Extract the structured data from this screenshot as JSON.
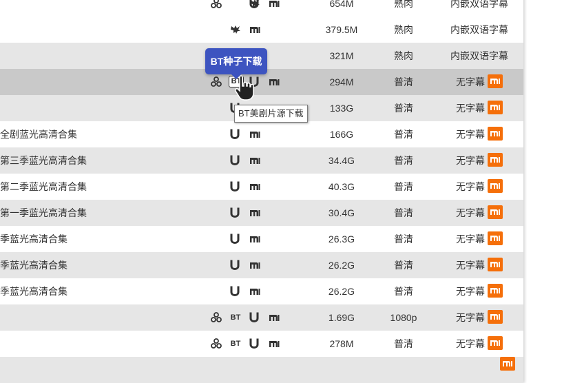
{
  "rows": [
    {
      "title": "",
      "icons": [
        "share",
        "magnet",
        "thunder",
        "mi"
      ],
      "size": "654M",
      "quality": "熟肉",
      "subtitle": "内嵌双语字幕",
      "mi_badge": false,
      "style": "plain"
    },
    {
      "title": "",
      "icons": [
        "thunder",
        "mi"
      ],
      "size": "379.5M",
      "quality": "熟肉",
      "subtitle": "内嵌双语字幕",
      "mi_badge": false,
      "style": "plain"
    },
    {
      "title": "",
      "icons": [],
      "size": "321M",
      "quality": "熟肉",
      "subtitle": "内嵌双语字幕",
      "mi_badge": false,
      "style": "alt"
    },
    {
      "title": "",
      "icons": [
        "share",
        "bt-boxed",
        "magnet",
        "mi"
      ],
      "size": "294M",
      "quality": "普清",
      "subtitle": "无字幕",
      "mi_badge": true,
      "style": "hover"
    },
    {
      "title": "",
      "icons": [
        "magnet"
      ],
      "size": "133G",
      "quality": "普清",
      "subtitle": "无字幕",
      "mi_badge": true,
      "style": "alt"
    },
    {
      "title": "全剧蓝光高清合集",
      "icons": [
        "magnet",
        "mi2"
      ],
      "size": "166G",
      "quality": "普清",
      "subtitle": "无字幕",
      "mi_badge": true,
      "style": "plain"
    },
    {
      "title": " 第三季蓝光高清合集",
      "icons": [
        "magnet",
        "mi2"
      ],
      "size": "34.4G",
      "quality": "普清",
      "subtitle": "无字幕",
      "mi_badge": true,
      "style": "alt"
    },
    {
      "title": " 第二季蓝光高清合集",
      "icons": [
        "magnet",
        "mi2"
      ],
      "size": "40.3G",
      "quality": "普清",
      "subtitle": "无字幕",
      "mi_badge": true,
      "style": "plain"
    },
    {
      "title": " 第一季蓝光高清合集",
      "icons": [
        "magnet",
        "mi2"
      ],
      "size": "30.4G",
      "quality": "普清",
      "subtitle": "无字幕",
      "mi_badge": true,
      "style": "alt"
    },
    {
      "title": "季蓝光高清合集",
      "icons": [
        "magnet",
        "mi2"
      ],
      "size": "26.3G",
      "quality": "普清",
      "subtitle": "无字幕",
      "mi_badge": true,
      "style": "plain"
    },
    {
      "title": "季蓝光高清合集",
      "icons": [
        "magnet",
        "mi2"
      ],
      "size": "26.2G",
      "quality": "普清",
      "subtitle": "无字幕",
      "mi_badge": true,
      "style": "alt"
    },
    {
      "title": "季蓝光高清合集",
      "icons": [
        "magnet",
        "mi2"
      ],
      "size": "26.2G",
      "quality": "普清",
      "subtitle": "无字幕",
      "mi_badge": true,
      "style": "plain"
    },
    {
      "title": "",
      "icons": [
        "share",
        "bt",
        "magnet",
        "mi"
      ],
      "size": "1.69G",
      "quality": "1080p",
      "subtitle": "无字幕",
      "mi_badge": true,
      "style": "alt"
    },
    {
      "title": "",
      "icons": [
        "share",
        "bt",
        "magnet",
        "mi"
      ],
      "size": "278M",
      "quality": "普清",
      "subtitle": "无字幕",
      "mi_badge": true,
      "style": "plain"
    },
    {
      "title": "",
      "icons": [],
      "size": "",
      "quality": "",
      "subtitle": "",
      "mi_badge": true,
      "style": "alt"
    }
  ],
  "bt_label": "BT",
  "popup": {
    "label": "BT种子下载"
  },
  "tooltip": {
    "label": "BT美剧片源下载"
  },
  "colors": {
    "accent": "#3d54c0",
    "mi_orange": "#f56f0a",
    "row_alt": "#e6e6e6",
    "row_hover": "#c9c9c9"
  }
}
